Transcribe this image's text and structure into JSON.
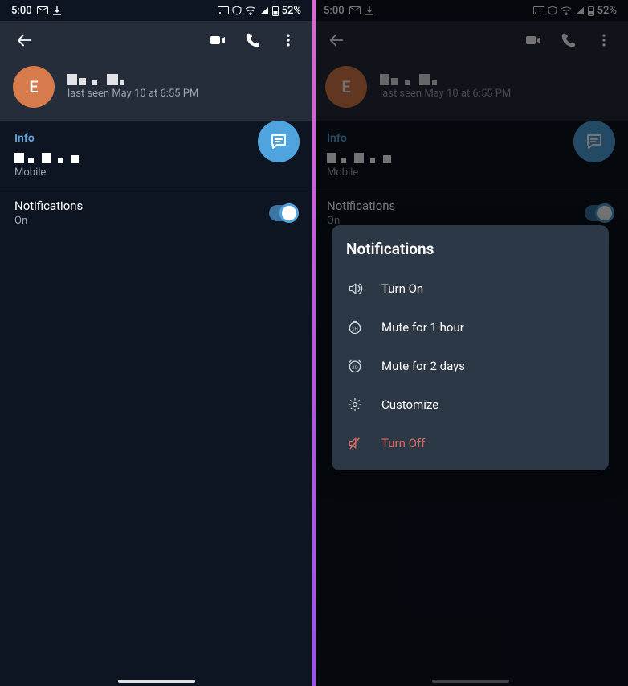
{
  "status": {
    "time": "5:00",
    "battery": "52%"
  },
  "profile": {
    "avatar_letter": "E",
    "last_seen": "last seen May 10 at 6:55 PM"
  },
  "info": {
    "section_title": "Info",
    "mobile_label": "Mobile"
  },
  "notifications": {
    "title": "Notifications",
    "status": "On"
  },
  "popup": {
    "title": "Notifications",
    "items": {
      "turn_on": "Turn On",
      "mute_1h": "Mute for 1 hour",
      "mute_2d": "Mute for 2 days",
      "customize": "Customize",
      "turn_off": "Turn Off"
    }
  }
}
